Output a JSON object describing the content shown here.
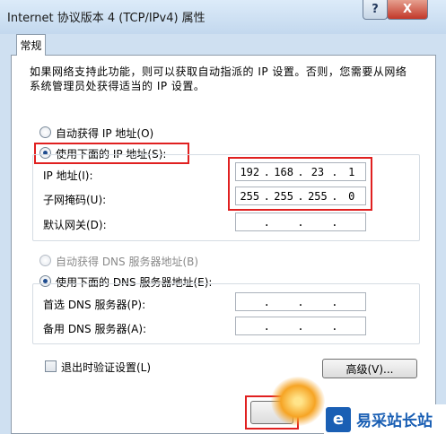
{
  "window": {
    "title": "Internet 协议版本 4 (TCP/IPv4) 属性",
    "help_label": "?",
    "close_label": "X"
  },
  "tab": {
    "label": "常规"
  },
  "description": "如果网络支持此功能，则可以获取自动指派的 IP 设置。否则，您需要从网络系统管理员处获得适当的 IP 设置。",
  "ip_section": {
    "auto_label": "自动获得 IP 地址(O)",
    "manual_label": "使用下面的 IP 地址(S):",
    "selected": "manual",
    "fields": [
      {
        "label": "IP 地址(I):",
        "octets": [
          "192",
          "168",
          "23",
          "1"
        ]
      },
      {
        "label": "子网掩码(U):",
        "octets": [
          "255",
          "255",
          "255",
          "0"
        ]
      },
      {
        "label": "默认网关(D):",
        "octets": [
          "",
          "",
          "",
          ""
        ]
      }
    ]
  },
  "dns_section": {
    "auto_label": "自动获得 DNS 服务器地址(B)",
    "manual_label": "使用下面的 DNS 服务器地址(E):",
    "selected": "manual",
    "fields": [
      {
        "label": "首选 DNS 服务器(P):",
        "octets": [
          "",
          "",
          "",
          ""
        ]
      },
      {
        "label": "备用 DNS 服务器(A):",
        "octets": [
          "",
          "",
          "",
          ""
        ]
      }
    ]
  },
  "validate_label": "退出时验证设置(L)",
  "advanced_label": "高级(V)...",
  "watermark": {
    "text": "易采站长站"
  },
  "colors": {
    "highlight": "#e02020",
    "accent": "#1a5fb4"
  }
}
